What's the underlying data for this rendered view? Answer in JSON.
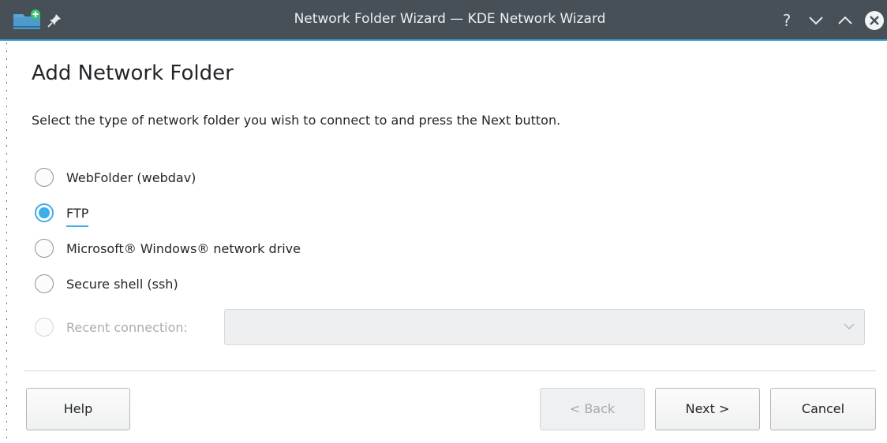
{
  "window": {
    "title": "Network Folder Wizard — KDE Network Wizard",
    "help_glyph": "?"
  },
  "page": {
    "heading": "Add Network Folder",
    "description": "Select the type of network folder you wish to connect to and press the Next button."
  },
  "options": [
    {
      "label": "WebFolder (webdav)",
      "checked": false,
      "enabled": true
    },
    {
      "label": "FTP",
      "checked": true,
      "enabled": true
    },
    {
      "label": "Microsoft® Windows® network drive",
      "checked": false,
      "enabled": true
    },
    {
      "label": "Secure shell (ssh)",
      "checked": false,
      "enabled": true
    },
    {
      "label": "Recent connection:",
      "checked": false,
      "enabled": false
    }
  ],
  "recent_combo": {
    "value": "",
    "enabled": false
  },
  "buttons": {
    "help": "Help",
    "back": "< Back",
    "next": "Next >",
    "cancel": "Cancel"
  },
  "colors": {
    "accent": "#3daee9",
    "titlebar": "#475057",
    "text": "#232629",
    "disabled_text": "#a8adb1"
  }
}
